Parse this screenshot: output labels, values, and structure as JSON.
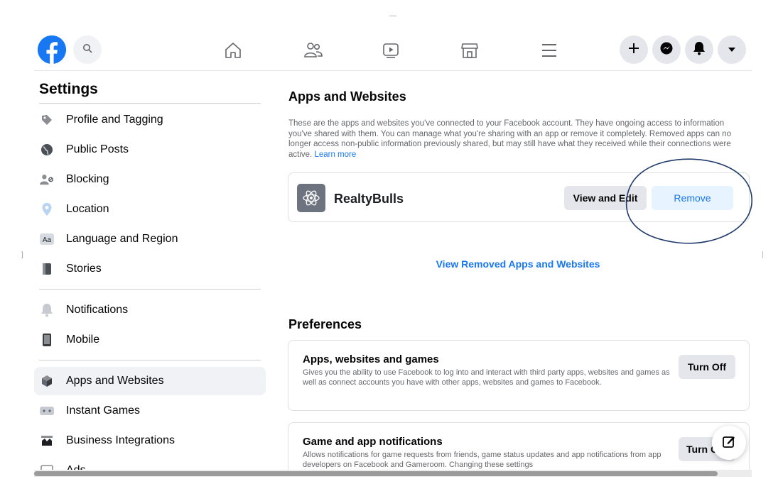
{
  "nav": {
    "icons": [
      "facebook-logo",
      "search-icon",
      "home-icon",
      "friends-icon",
      "watch-icon",
      "marketplace-icon",
      "menu-icon",
      "plus-icon",
      "messenger-icon",
      "notifications-icon",
      "account-caret-icon"
    ]
  },
  "sidebar": {
    "title": "Settings",
    "items": [
      {
        "label": "Profile and Tagging",
        "icon": "tag-icon"
      },
      {
        "label": "Public Posts",
        "icon": "globe-icon"
      },
      {
        "label": "Blocking",
        "icon": "blocked-user-icon"
      },
      {
        "label": "Location",
        "icon": "location-pin-icon"
      },
      {
        "label": "Language and Region",
        "icon": "language-aa-icon"
      },
      {
        "label": "Stories",
        "icon": "book-icon"
      },
      {
        "label": "Notifications",
        "icon": "bell-icon"
      },
      {
        "label": "Mobile",
        "icon": "phone-icon"
      },
      {
        "label": "Apps and Websites",
        "icon": "cube-icon",
        "active": true
      },
      {
        "label": "Instant Games",
        "icon": "gamepad-icon"
      },
      {
        "label": "Business Integrations",
        "icon": "business-icon"
      },
      {
        "label": "Ads",
        "icon": "ads-icon"
      }
    ]
  },
  "main": {
    "title": "Apps and Websites",
    "description": "These are the apps and websites you've connected to your Facebook account. They have ongoing access to information you've shared with them. You can manage what you're sharing with an app or remove it completely. Removed apps can no longer access non-public information previously shared, but may still have what they received while their connections were active.",
    "learn_more": "Learn more",
    "app": {
      "name": "RealtyBulls",
      "icon": "atom-icon",
      "view_edit_label": "View and Edit",
      "remove_label": "Remove"
    },
    "view_removed_label": "View Removed Apps and Websites",
    "preferences_title": "Preferences",
    "preferences": [
      {
        "title": "Apps, websites and games",
        "description": "Gives you the ability to use Facebook to log into and interact with third party apps, websites and games as well as connect accounts you have with other apps, websites and games to Facebook.",
        "button": "Turn Off"
      },
      {
        "title": "Game and app notifications",
        "description": "Allows notifications for game requests from friends, game status updates and app notifications from app developers on Facebook and Gameroom. Changing these settings",
        "button": "Turn Off"
      }
    ]
  },
  "colors": {
    "accent": "#1877f2",
    "annotation": "#1f3a6b"
  }
}
